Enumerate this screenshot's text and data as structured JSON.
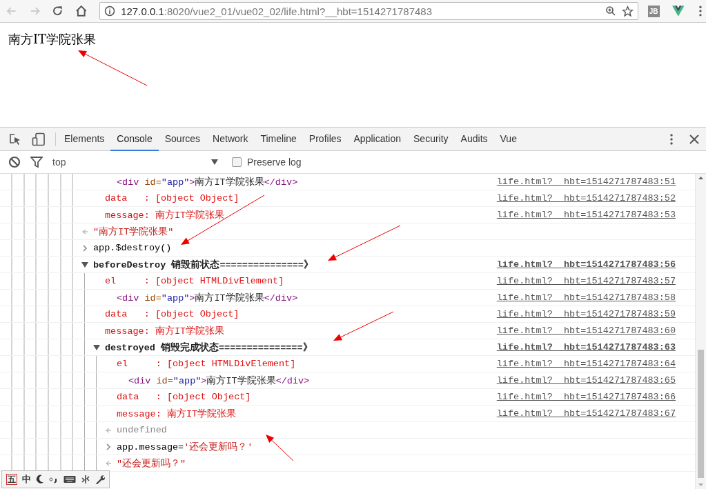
{
  "browser": {
    "back_disabled": true,
    "forward_disabled": true,
    "url": {
      "host": "127.0.0.1",
      "path": ":8020/vue2_01/vue02_02/life.html?__hbt=1514271787483"
    },
    "extension_label": "JB"
  },
  "page": {
    "text": "南方IT学院张果"
  },
  "devtools": {
    "tabs": [
      {
        "label": "Elements",
        "selected": false
      },
      {
        "label": "Console",
        "selected": true
      },
      {
        "label": "Sources",
        "selected": false
      },
      {
        "label": "Network",
        "selected": false
      },
      {
        "label": "Timeline",
        "selected": false
      },
      {
        "label": "Profiles",
        "selected": false
      },
      {
        "label": "Application",
        "selected": false
      },
      {
        "label": "Security",
        "selected": false
      },
      {
        "label": "Audits",
        "selected": false
      },
      {
        "label": "Vue",
        "selected": false
      }
    ],
    "context": "top",
    "preserve_log": {
      "label": "Preserve log",
      "checked": false
    },
    "console": [
      {
        "kind": "continued",
        "children": [
          {
            "kind": "continued",
            "children": [
              {
                "kind": "html",
                "segments": [
                  {
                    "kind": "tag",
                    "text": "<div "
                  },
                  {
                    "kind": "attr-name",
                    "text": "id="
                  },
                  {
                    "kind": "attr-value",
                    "text": "\"app\""
                  },
                  {
                    "kind": "tag",
                    "text": ">"
                  },
                  {
                    "kind": "text",
                    "text": "南方IT学院张果"
                  },
                  {
                    "kind": "tag",
                    "text": "</div>"
                  }
                ],
                "source": "life.html?__hbt=1514271787483:51"
              }
            ]
          },
          {
            "kind": "log",
            "label": "data   :",
            "value": "[object Object]",
            "source": "life.html?__hbt=1514271787483:52"
          },
          {
            "kind": "log",
            "label": "message:",
            "value": "南方IT学院张果",
            "source": "life.html?__hbt=1514271787483:53"
          }
        ]
      },
      {
        "kind": "string-result",
        "text": "\"南方IT学院张果\""
      },
      {
        "kind": "input",
        "segments": [
          {
            "kind": "code",
            "text": "app.$destroy()"
          }
        ]
      },
      {
        "kind": "group",
        "expanded": true,
        "text": "beforeDestroy 销毁前状态===============》",
        "source": "life.html?__hbt=1514271787483:56",
        "children": [
          {
            "kind": "log",
            "label": "el     :",
            "value": "[object HTMLDivElement]",
            "source": "life.html?__hbt=1514271787483:57",
            "children": [
              {
                "kind": "html",
                "segments": [
                  {
                    "kind": "tag",
                    "text": "<div "
                  },
                  {
                    "kind": "attr-name",
                    "text": "id="
                  },
                  {
                    "kind": "attr-value",
                    "text": "\"app\""
                  },
                  {
                    "kind": "tag",
                    "text": ">"
                  },
                  {
                    "kind": "text",
                    "text": "南方IT学院张果"
                  },
                  {
                    "kind": "tag",
                    "text": "</div>"
                  }
                ],
                "source": "life.html?__hbt=1514271787483:58"
              }
            ]
          },
          {
            "kind": "log",
            "label": "data   :",
            "value": "[object Object]",
            "source": "life.html?__hbt=1514271787483:59"
          },
          {
            "kind": "log",
            "label": "message:",
            "value": "南方IT学院张果",
            "source": "life.html?__hbt=1514271787483:60"
          },
          {
            "kind": "group",
            "expanded": true,
            "text": "destroyed 销毁完成状态===============》",
            "source": "life.html?__hbt=1514271787483:63",
            "children": [
              {
                "kind": "log",
                "label": "el     :",
                "value": "[object HTMLDivElement]",
                "source": "life.html?__hbt=1514271787483:64",
                "children": [
                  {
                    "kind": "html",
                    "segments": [
                      {
                        "kind": "tag",
                        "text": "<div "
                      },
                      {
                        "kind": "attr-name",
                        "text": "id="
                      },
                      {
                        "kind": "attr-value",
                        "text": "\"app\""
                      },
                      {
                        "kind": "tag",
                        "text": ">"
                      },
                      {
                        "kind": "text",
                        "text": "南方IT学院张果"
                      },
                      {
                        "kind": "tag",
                        "text": "</div>"
                      }
                    ],
                    "source": "life.html?__hbt=1514271787483:65"
                  }
                ]
              },
              {
                "kind": "log",
                "label": "data   :",
                "value": "[object Object]",
                "source": "life.html?__hbt=1514271787483:66"
              },
              {
                "kind": "log",
                "label": "message:",
                "value": "南方IT学院张果",
                "source": "life.html?__hbt=1514271787483:67"
              },
              {
                "kind": "undefined-result",
                "text": "undefined"
              },
              {
                "kind": "input",
                "segments": [
                  {
                    "kind": "code",
                    "text": "app.message="
                  },
                  {
                    "kind": "string",
                    "text": "'还会更新吗？'"
                  }
                ]
              },
              {
                "kind": "string-result",
                "text": "\"还会更新吗？\""
              }
            ]
          }
        ]
      }
    ]
  },
  "ime_bar": {
    "mode_label": "五",
    "language_label": "中"
  }
}
